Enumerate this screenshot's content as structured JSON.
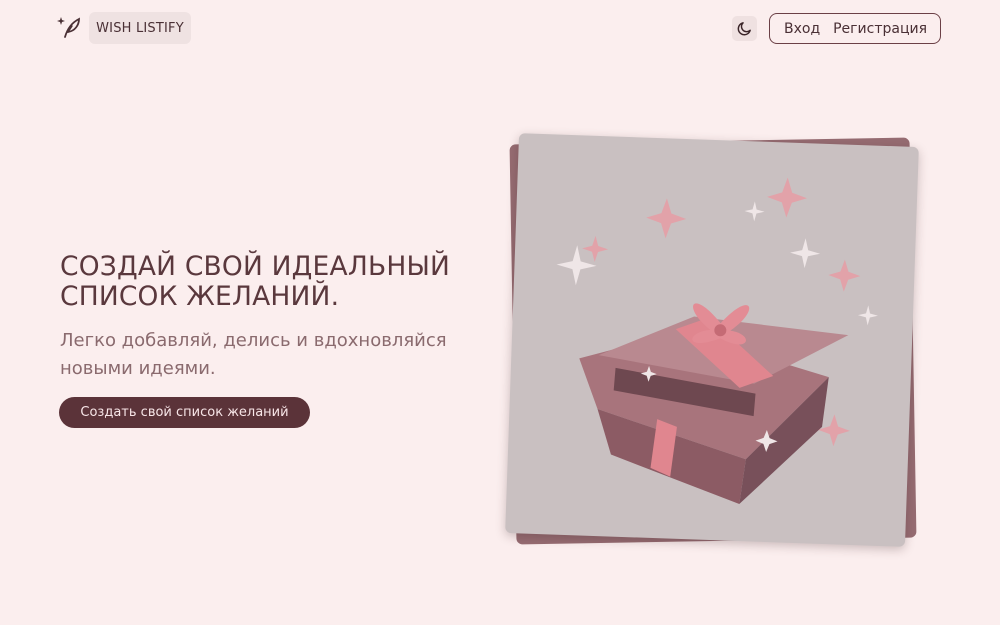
{
  "header": {
    "logo_icon": "feather-sparkle-icon",
    "brand": "WISH LISTIFY",
    "theme_icon": "moon-icon",
    "login": "Вход",
    "register": "Регистрация"
  },
  "hero": {
    "title_line1": "СОЗДАЙ СВОЙ ИДЕАЛЬНЫЙ",
    "title_line2": "СПИСОК ЖЕЛАНИЙ.",
    "subtitle": "Легко добавляй, делись и вдохновляйся новыми идеями.",
    "cta": "Создать свой список желаний"
  },
  "colors": {
    "background": "#fbeeee",
    "accent": "#5b3339",
    "card_back": "#966c72",
    "card_front": "#c9c0c1",
    "gift_pink": "#e0868f"
  },
  "illustration": {
    "icon": "open-gift-box-icon"
  }
}
